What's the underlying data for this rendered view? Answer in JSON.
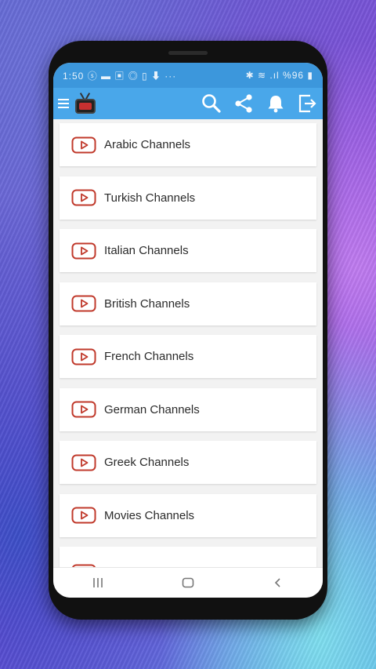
{
  "status_bar": {
    "time": "1:50",
    "left_icons": "ⓢ ▬ ▣ ◎ ▯ ⬇ ···",
    "right_text": "✱ ≋ .ıl %96 ▮"
  },
  "toolbar": {
    "icons": [
      "menu-icon",
      "app-logo",
      "search-icon",
      "share-icon",
      "bell-icon",
      "exit-icon"
    ]
  },
  "categories": [
    {
      "label": "Arabic Channels"
    },
    {
      "label": "Turkish Channels"
    },
    {
      "label": "Italian Channels"
    },
    {
      "label": "British Channels"
    },
    {
      "label": "French Channels"
    },
    {
      "label": "German Channels"
    },
    {
      "label": "Greek Channels"
    },
    {
      "label": "Movies Channels"
    }
  ],
  "colors": {
    "status_bar": "#3c97dc",
    "toolbar": "#49a7ea",
    "item_icon": "#c0392b"
  }
}
